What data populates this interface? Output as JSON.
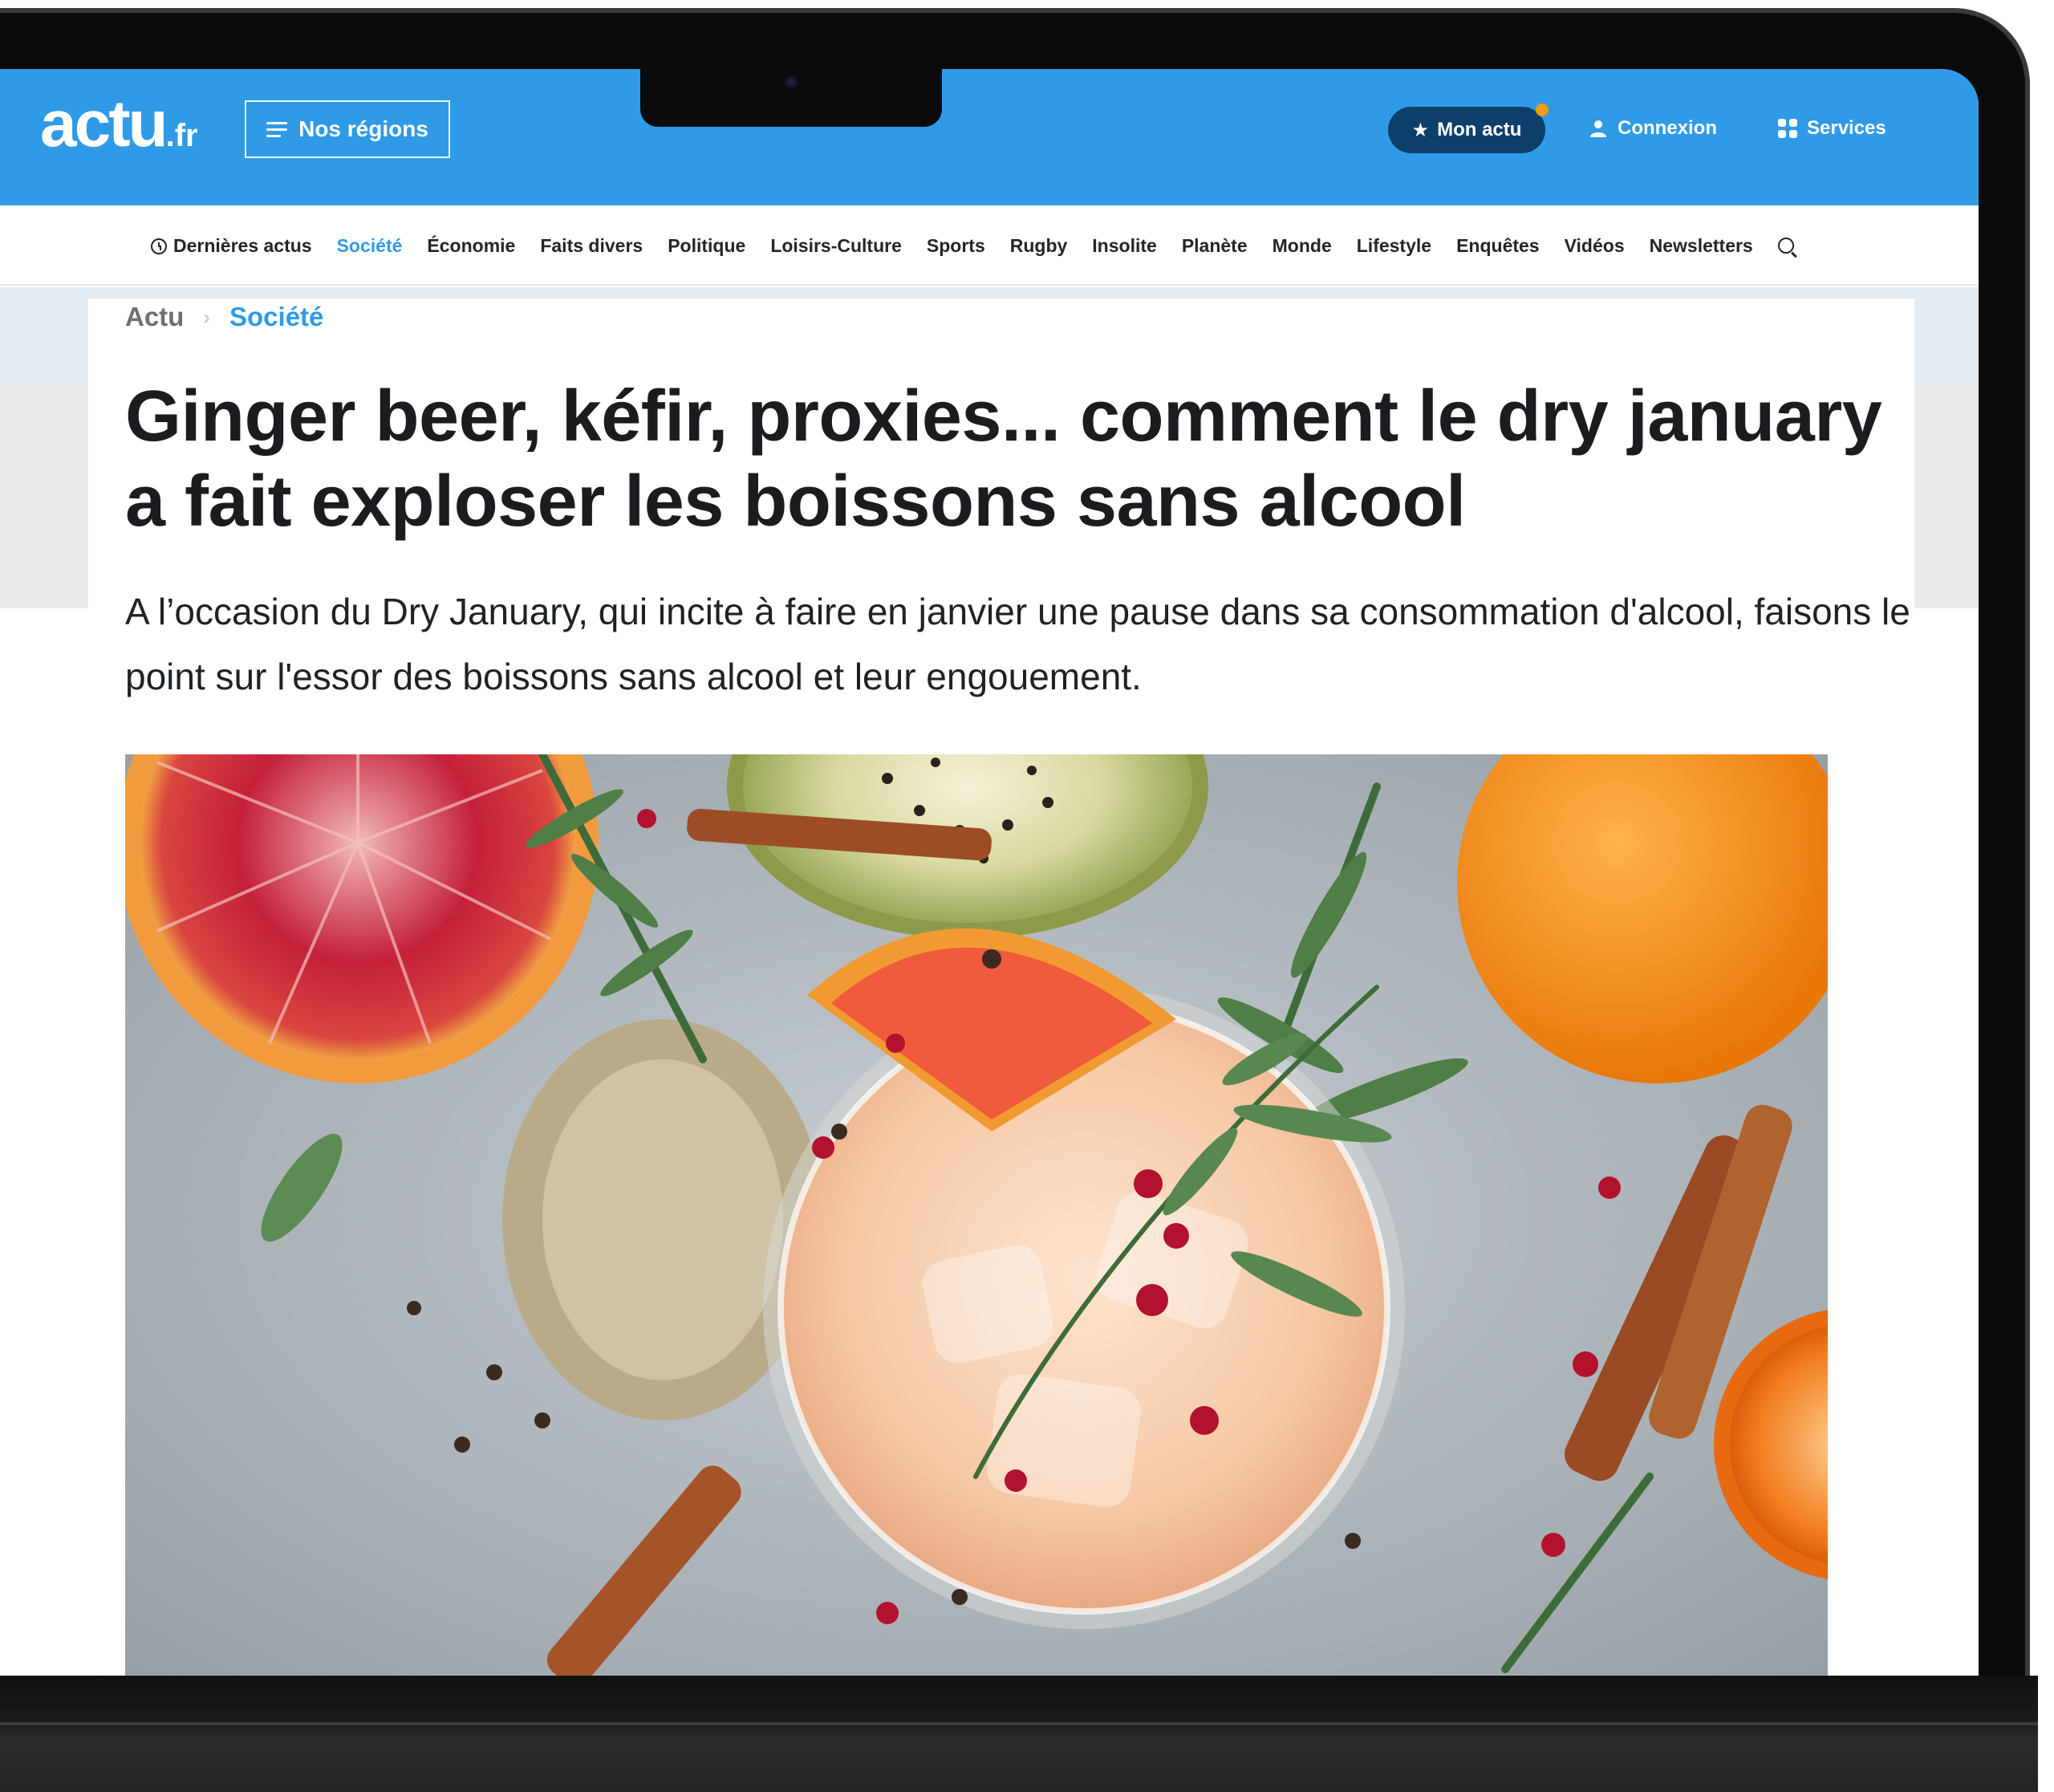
{
  "header": {
    "logo_main": "actu",
    "logo_tld": ".fr",
    "regions_label": "Nos régions",
    "mon_actu_label": "Mon actu",
    "login_label": "Connexion",
    "services_label": "Services"
  },
  "nav": {
    "latest": "Dernières actus",
    "items": [
      "Société",
      "Économie",
      "Faits divers",
      "Politique",
      "Loisirs-Culture",
      "Sports",
      "Rugby",
      "Insolite",
      "Planète",
      "Monde",
      "Lifestyle",
      "Enquêtes",
      "Vidéos",
      "Newsletters"
    ],
    "active": "Société"
  },
  "breadcrumb": {
    "root": "Actu",
    "current": "Société"
  },
  "article": {
    "title": "Ginger beer, kéfir, proxies... comment le dry january a fait exploser les boissons sans alcool",
    "lead": "A l’occasion du Dry January, qui incite à faire en janvier une pause dans sa consommation d'alcool, faisons le point sur l'essor des boissons sans alcool et leur engouement."
  },
  "icons": {
    "menu": "hamburger-icon",
    "star": "star-icon",
    "user": "user-icon",
    "services": "grid-icon",
    "clock": "clock-icon",
    "search": "search-icon"
  },
  "colors": {
    "brand": "#2f9be6",
    "mon_actu_bg": "#0d3f6b",
    "notification_dot": "#f39c12",
    "text": "#1a1c1f"
  }
}
